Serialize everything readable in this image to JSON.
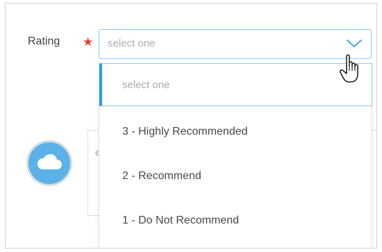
{
  "form": {
    "rating_label": "Rating",
    "required_marker": "★",
    "select_value": "select one",
    "comment_hint": "e"
  },
  "dropdown": {
    "options": [
      {
        "label": "select one",
        "placeholder": true
      },
      {
        "label": "3 - Highly Recommended"
      },
      {
        "label": "2 - Recommend"
      },
      {
        "label": "1 - Do Not Recommend"
      }
    ]
  },
  "icons": {
    "chevron": "chevron-down-icon",
    "cursor": "hand-pointer-icon",
    "avatar": "cloud-icon"
  },
  "colors": {
    "accent": "#2e9be0",
    "focus_border": "#8fc6ec",
    "required": "#e53935",
    "avatar_bg": "#5ab2e8",
    "placeholder_text": "#a8acb2"
  }
}
